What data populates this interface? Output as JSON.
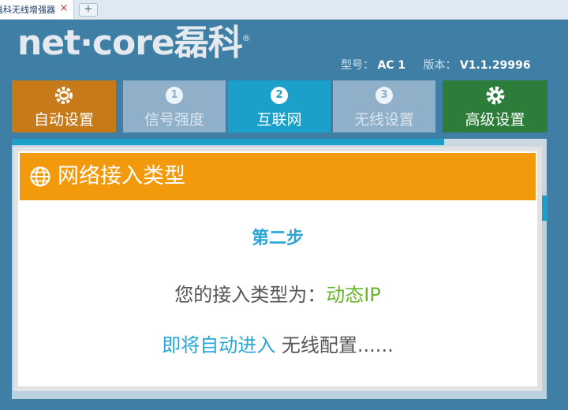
{
  "browser": {
    "tab_title": "磊科无线增强器",
    "tab_close": "×",
    "new_tab": "+"
  },
  "header": {
    "logo_text": "net·core磊科",
    "logo_reg": "®",
    "model_label": "型号：",
    "model_value": "AC 1",
    "version_label": "版本：",
    "version_value": "V1.1.29996"
  },
  "nav": {
    "auto": {
      "label": "自动设置",
      "icon": "gear-refresh-icon"
    },
    "step1": {
      "number": "1",
      "label": "信号强度"
    },
    "step2": {
      "number": "2",
      "label": "互联网"
    },
    "step3": {
      "number": "3",
      "label": "无线设置"
    },
    "advanced": {
      "label": "高级设置",
      "icon": "gear-icon"
    }
  },
  "dialog": {
    "title": "网络接入类型",
    "icon": "globe-icon",
    "step_title": "第二步",
    "type_prefix": "您的接入类型为：",
    "type_value": "动态IP",
    "enter_highlight": "即将自动进入",
    "enter_rest": " 无线配置......"
  },
  "colors": {
    "background": "#3f7fa6",
    "auto_nav": "#c77a1a",
    "step_inactive": "#8fb0c8",
    "step_active": "#1aa0c9",
    "advanced_nav": "#2d7d3a",
    "dialog_header": "#f39a0c",
    "highlight_blue": "#2aa6d6",
    "value_green": "#6ab42a"
  }
}
